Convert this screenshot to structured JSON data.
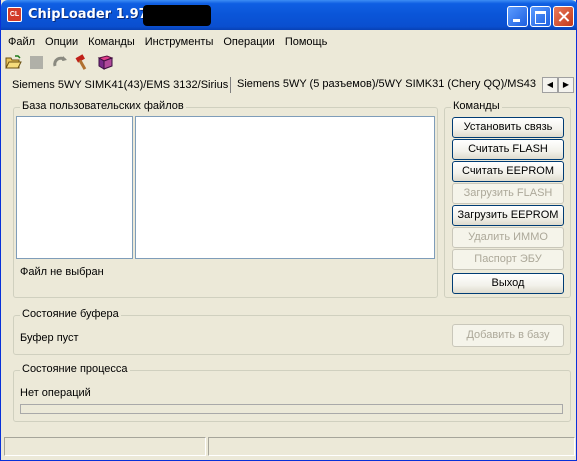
{
  "window": {
    "title": "ChipLoader 1.97.6",
    "icon": "CL"
  },
  "menu": [
    "Файл",
    "Опции",
    "Команды",
    "Инструменты",
    "Операции",
    "Помощь"
  ],
  "toolbar": {
    "icons": [
      "open-folder-icon",
      "stop-icon",
      "refresh-icon",
      "hammer-icon",
      "book-icon"
    ]
  },
  "tabs": [
    {
      "label": "Siemens 5WY SIMK41(43)/EMS 3132/Sirius",
      "active": false
    },
    {
      "label": "Siemens 5WY (5 разъемов)/5WY SIMK31 (Chery QQ)/MS43",
      "active": true
    }
  ],
  "user_db": {
    "title": "База пользовательских файлов",
    "status": "Файл не выбран"
  },
  "commands": {
    "title": "Команды",
    "buttons": [
      {
        "label": "Установить связь",
        "enabled": true
      },
      {
        "label": "Считать FLASH",
        "enabled": true
      },
      {
        "label": "Считать EEPROM",
        "enabled": true
      },
      {
        "label": "Загрузить FLASH",
        "enabled": false
      },
      {
        "label": "Загрузить EEPROM",
        "enabled": true
      },
      {
        "label": "Удалить ИММО",
        "enabled": false
      },
      {
        "label": "Паспорт ЭБУ",
        "enabled": false
      },
      {
        "label": "Выход",
        "enabled": true
      }
    ]
  },
  "buffer": {
    "title": "Состояние буфера",
    "status": "Буфер пуст",
    "add_button": "Добавить в базу"
  },
  "process": {
    "title": "Состояние процесса",
    "status": "Нет операций",
    "progress": 0
  }
}
